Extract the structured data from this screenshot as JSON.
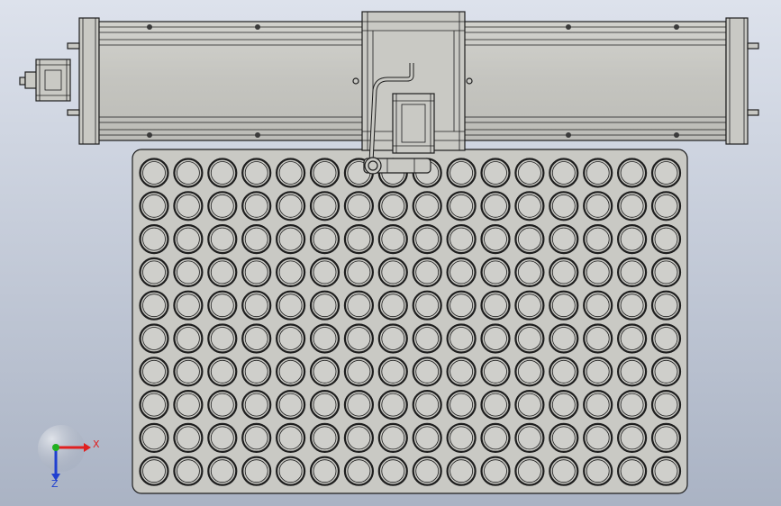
{
  "viewport": {
    "background_top": "#dde2ec",
    "background_bottom": "#aab3c4"
  },
  "model": {
    "part_color": "#c9c9c4",
    "edge_color": "#1e1e1e",
    "hole_fill": "#cfcfcb",
    "tray": {
      "hole_columns": 16,
      "hole_rows": 10
    }
  },
  "triad": {
    "x_label": "X",
    "z_label": "Z",
    "x_color": "#e02020",
    "y_color": "#20b020",
    "z_color": "#2040d0"
  }
}
